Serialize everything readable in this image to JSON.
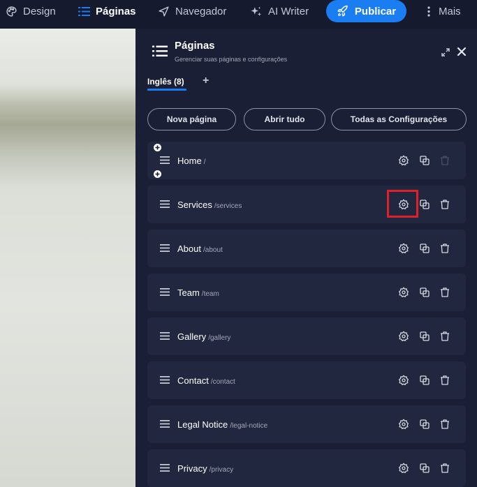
{
  "topbar": {
    "items": [
      {
        "label": "Design",
        "icon": "palette-icon"
      },
      {
        "label": "Páginas",
        "icon": "pages-list-icon",
        "active": true
      },
      {
        "label": "Navegador",
        "icon": "navigator-icon"
      },
      {
        "label": "AI Writer",
        "icon": "sparkle-icon"
      },
      {
        "label": "Mais",
        "icon": "more-vertical-icon"
      }
    ],
    "publish_label": "Publicar",
    "accent": "#1a7ef2"
  },
  "panel": {
    "title": "Páginas",
    "subtitle": "Gerenciar suas páginas e configurações",
    "language_tab": "Inglês (8)",
    "actions": {
      "new_page": "Nova página",
      "open_all": "Abrir tudo",
      "all_settings": "Todas as Configurações"
    },
    "pages": [
      {
        "name": "Home",
        "slug": "/",
        "delete_disabled": true
      },
      {
        "name": "Services",
        "slug": "/services",
        "highlighted": true
      },
      {
        "name": "About",
        "slug": "/about"
      },
      {
        "name": "Team",
        "slug": "/team"
      },
      {
        "name": "Gallery",
        "slug": "/gallery"
      },
      {
        "name": "Contact",
        "slug": "/contact"
      },
      {
        "name": "Legal Notice",
        "slug": "/legal-notice"
      },
      {
        "name": "Privacy",
        "slug": "/privacy"
      }
    ]
  },
  "colors": {
    "highlight": "#e0202a",
    "background": "#151a2e",
    "row": "#21273f"
  }
}
